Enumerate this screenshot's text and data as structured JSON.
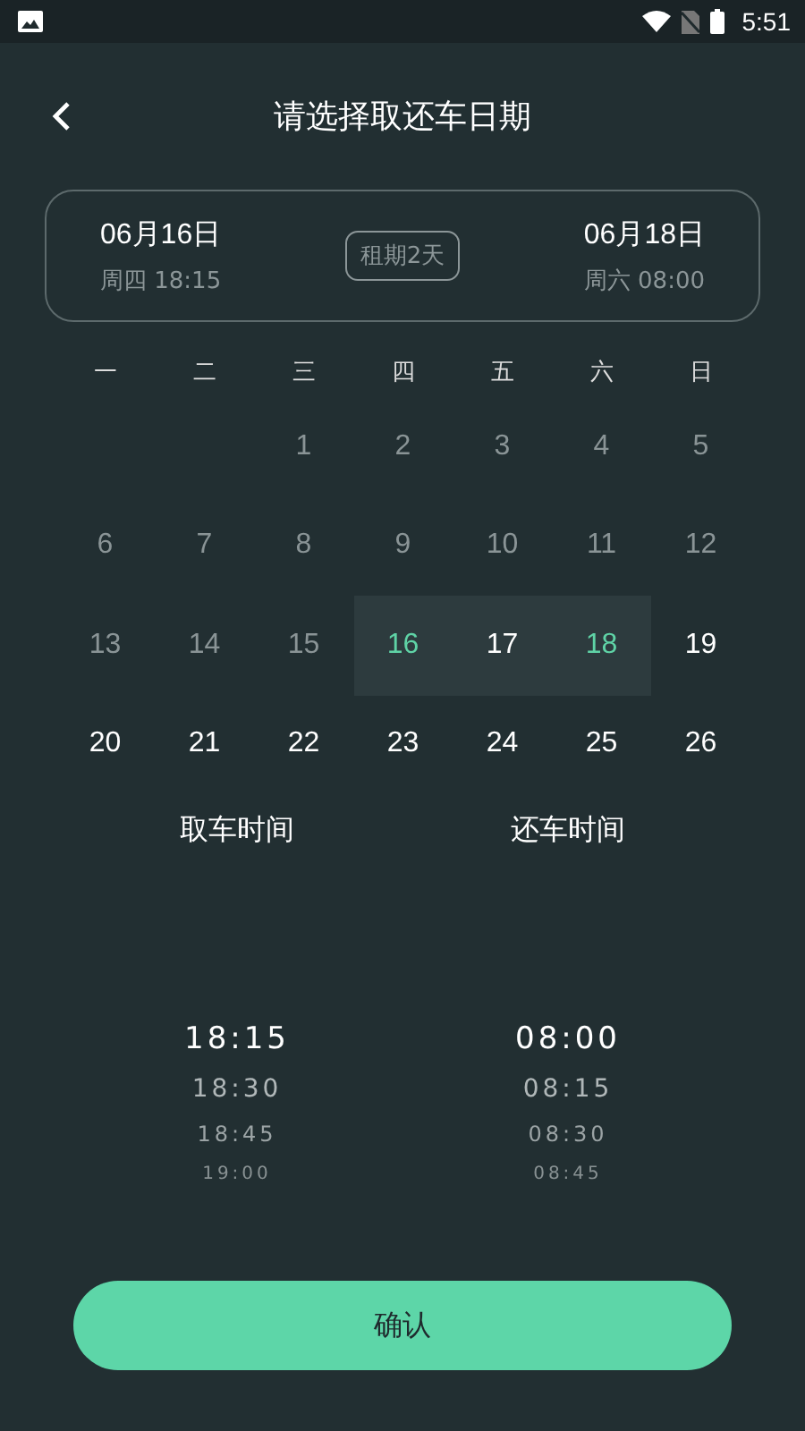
{
  "status_bar": {
    "time": "5:51"
  },
  "header": {
    "title": "请选择取还车日期"
  },
  "summary": {
    "pickup": {
      "date": "06月16日",
      "detail": "周四 18:15"
    },
    "duration": "租期2天",
    "return": {
      "date": "06月18日",
      "detail": "周六 08:00"
    }
  },
  "weekdays": [
    "一",
    "二",
    "三",
    "四",
    "五",
    "六",
    "日"
  ],
  "days": [
    {
      "kind": "blank"
    },
    {
      "kind": "blank"
    },
    {
      "label": "1",
      "kind": "past"
    },
    {
      "label": "2",
      "kind": "past"
    },
    {
      "label": "3",
      "kind": "past"
    },
    {
      "label": "4",
      "kind": "past"
    },
    {
      "label": "5",
      "kind": "past"
    },
    {
      "label": "6",
      "kind": "past"
    },
    {
      "label": "7",
      "kind": "past"
    },
    {
      "label": "8",
      "kind": "past"
    },
    {
      "label": "9",
      "kind": "past"
    },
    {
      "label": "10",
      "kind": "past"
    },
    {
      "label": "11",
      "kind": "past"
    },
    {
      "label": "12",
      "kind": "past"
    },
    {
      "label": "13",
      "kind": "past"
    },
    {
      "label": "14",
      "kind": "past"
    },
    {
      "label": "15",
      "kind": "past"
    },
    {
      "label": "16",
      "kind": "start"
    },
    {
      "label": "17",
      "kind": "range"
    },
    {
      "label": "18",
      "kind": "end"
    },
    {
      "label": "19",
      "kind": "normal"
    },
    {
      "label": "20",
      "kind": "normal"
    },
    {
      "label": "21",
      "kind": "normal"
    },
    {
      "label": "22",
      "kind": "normal"
    },
    {
      "label": "23",
      "kind": "normal"
    },
    {
      "label": "24",
      "kind": "normal"
    },
    {
      "label": "25",
      "kind": "normal"
    },
    {
      "label": "26",
      "kind": "normal"
    }
  ],
  "time_pickers": [
    {
      "title": "取车时间",
      "options": [
        {
          "label": "18:15",
          "selected": true
        },
        {
          "label": "18:30",
          "selected": false
        },
        {
          "label": "18:45",
          "selected": false
        },
        {
          "label": "19:00",
          "selected": false
        }
      ]
    },
    {
      "title": "还车时间",
      "options": [
        {
          "label": "08:00",
          "selected": true
        },
        {
          "label": "08:15",
          "selected": false
        },
        {
          "label": "08:30",
          "selected": false
        },
        {
          "label": "08:45",
          "selected": false
        }
      ]
    }
  ],
  "confirm_button": "确认"
}
